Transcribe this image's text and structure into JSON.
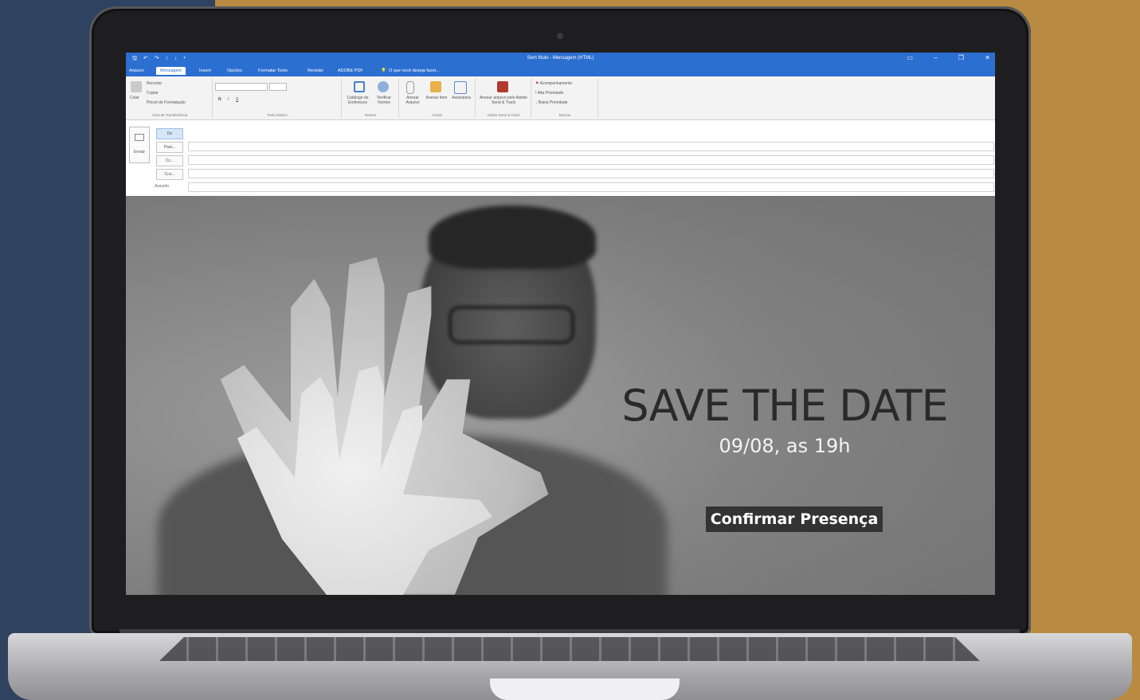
{
  "window": {
    "title": "Sem título - Mensagem (HTML)",
    "quick_access": "🖫 ↶ ↷ ↑ ↓ ▾",
    "controls": [
      "▭",
      "–",
      "❐",
      "✕"
    ]
  },
  "tabs": [
    {
      "label": "Arquivo"
    },
    {
      "label": "Mensagem"
    },
    {
      "label": "Inserir"
    },
    {
      "label": "Opções"
    },
    {
      "label": "Formatar Texto"
    },
    {
      "label": "Revisão"
    },
    {
      "label": "ADOBE PDF"
    }
  ],
  "tell_me": "O que você deseja fazer...",
  "ribbon": {
    "clipboard": {
      "paste": "Colar",
      "cut": "Recortar",
      "copy": "Copiar",
      "format_painter": "Pincel de Formatação",
      "label": "Área de Transferência"
    },
    "basic_text": {
      "label": "Texto Básico",
      "bold": "N",
      "italic": "I",
      "underline": "S"
    },
    "names": {
      "address_book": "Catálogo de Endereços",
      "check_names": "Verificar Nomes",
      "label": "Nomes"
    },
    "include": {
      "attach_file": "Anexar Arquivo",
      "attach_item": "Anexar Item",
      "signature": "Assinatura",
      "label": "Incluir"
    },
    "adobe": {
      "attach_adobe": "Anexar arquivo pelo Adobe Send & Track",
      "label": "Adobe Send & Track"
    },
    "tags": {
      "follow_up": "Acompanhamento",
      "high": "Alta Prioridade",
      "low": "Baixa Prioridade",
      "label": "Marcas"
    }
  },
  "compose": {
    "send": "Enviar",
    "from": "De",
    "to": "Para...",
    "cc": "Cc...",
    "bcc": "Cco...",
    "subject": "Assunto"
  },
  "email_body": {
    "headline": "SAVE THE DATE",
    "when": "09/08, as 19h",
    "cta": "Confirmar Presença"
  },
  "colors": {
    "background_left": "#2f4360",
    "background_right": "#b98a41",
    "outlook_blue": "#2b6fd0",
    "cta_bg": "#333333"
  }
}
